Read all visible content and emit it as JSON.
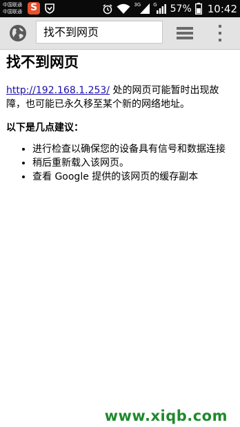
{
  "status_bar": {
    "carrier_1": "中国联通",
    "carrier_2": "中国联通",
    "network_3g": "3G",
    "network_g": "G",
    "battery_percent": "57%",
    "time": "10:42"
  },
  "toolbar": {
    "url_text": "找不到网页"
  },
  "page": {
    "title": "找不到网页",
    "link_text": "http://192.168.1.253/",
    "message_rest": " 处的网页可能暂时出现故障，也可能已永久移至某个新的网络地址。",
    "suggestions_heading": "以下是几点建议：",
    "suggestions": [
      "进行检查以确保您的设备具有信号和数据连接",
      "稍后重新载入该网页。",
      "查看 Google 提供的该网页的缓存副本"
    ]
  },
  "watermark": "www.xiqb.com",
  "colors": {
    "link": "#1a0dab",
    "watermark": "#1f8a2e",
    "toolbar_bg": "#e3e3e3"
  },
  "icons": [
    "globe-icon",
    "tabs-stack-icon",
    "overflow-menu-icon",
    "alarm-icon",
    "wifi-icon",
    "signal-icon",
    "battery-icon"
  ]
}
